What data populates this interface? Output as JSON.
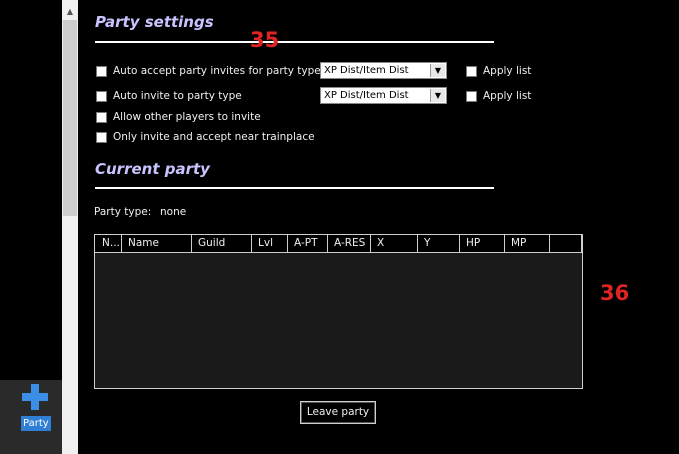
{
  "sidebar": {
    "party_label": "Party"
  },
  "party_settings": {
    "title": "Party settings",
    "annotation": "35",
    "options": [
      {
        "label": "Auto accept party invites for party type",
        "checked": false,
        "select_value": "XP Dist/Item Dist",
        "apply_label": "Apply list"
      },
      {
        "label": "Auto invite to party type",
        "checked": false,
        "select_value": "XP Dist/Item Dist",
        "apply_label": "Apply list"
      },
      {
        "label": "Allow other players to invite",
        "checked": false
      },
      {
        "label": "Only invite and accept near trainplace",
        "checked": false
      }
    ]
  },
  "current_party": {
    "title": "Current party",
    "party_type_label": "Party type:",
    "party_type_value": "none",
    "columns": [
      "N...",
      "Name",
      "Guild",
      "Lvl",
      "A-PT",
      "A-RES",
      "X",
      "Y",
      "HP",
      "MP",
      ""
    ],
    "rows": [],
    "annotation": "36",
    "leave_button": "Leave party"
  },
  "colors": {
    "accent_title": "#c7c4ff",
    "annotation": "#e02424",
    "party_tab": "#2f7fd6"
  },
  "icons": {
    "party": "plus-icon",
    "scroll_up": "chevron-up-icon",
    "dropdown": "chevron-down-icon"
  }
}
